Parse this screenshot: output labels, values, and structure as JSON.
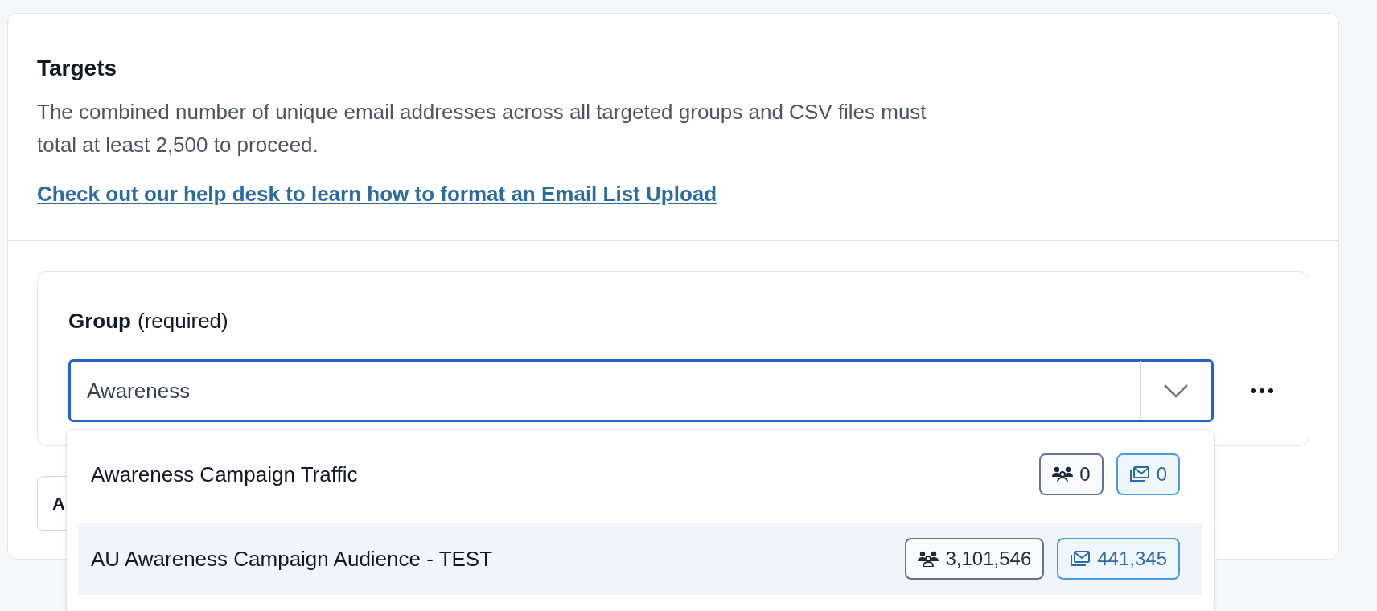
{
  "section": {
    "title": "Targets",
    "description": "The combined number of unique email addresses across all targeted groups and CSV files must total at least 2,500 to proceed.",
    "help_link": "Check out our help desk to learn how to format an Email List Upload"
  },
  "group_field": {
    "label": "Group",
    "label_note": "(required)",
    "value": "Awareness",
    "focused": true
  },
  "hidden_button": {
    "label": "A"
  },
  "dropdown": [
    {
      "name": "Awareness Campaign Traffic",
      "members": "0",
      "emails": "0",
      "selected": false
    },
    {
      "name": "AU Awareness Campaign Audience - TEST",
      "members": "3,101,546",
      "emails": "441,345",
      "selected": true
    }
  ]
}
